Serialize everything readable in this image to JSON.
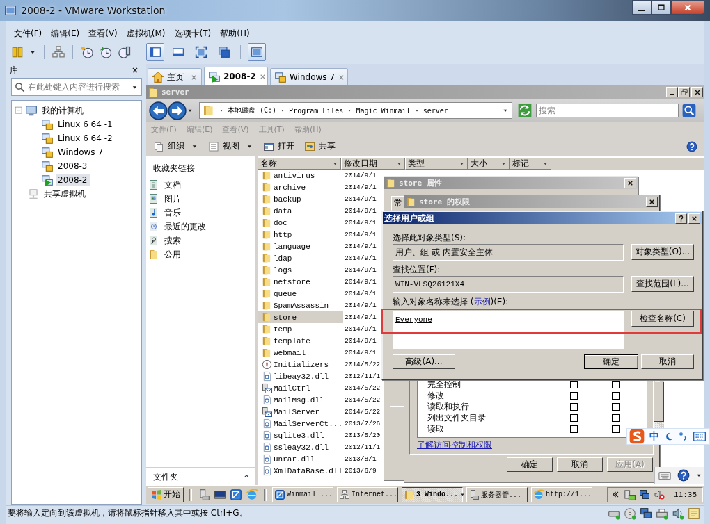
{
  "window": {
    "title": "2008-2 - VMware Workstation"
  },
  "menu": [
    "文件(F)",
    "编辑(E)",
    "查看(V)",
    "虚拟机(M)",
    "选项卡(T)",
    "帮助(H)"
  ],
  "view_modes": [
    {
      "on": true
    },
    {
      "on": false
    },
    {
      "on": false
    },
    {
      "on": false
    },
    {
      "on": true
    }
  ],
  "library": {
    "title": "库",
    "search_placeholder": "在此处键入内容进行搜索",
    "tree": [
      {
        "label": "我的计算机",
        "kind": "computer",
        "expanded": true,
        "selected": false,
        "children": [
          {
            "label": "Linux 6 64 -1",
            "kind": "vm",
            "selected": false
          },
          {
            "label": "Linux 6 64 -2",
            "kind": "vm",
            "selected": false
          },
          {
            "label": "Windows 7",
            "kind": "vm",
            "selected": false
          },
          {
            "label": "2008-3",
            "kind": "vm",
            "selected": false
          },
          {
            "label": "2008-2",
            "kind": "vm-running",
            "selected": true
          }
        ]
      },
      {
        "label": "共享虚拟机",
        "kind": "shared",
        "selected": false
      }
    ]
  },
  "tabs": [
    {
      "label": "主页",
      "kind": "home",
      "selected": false
    },
    {
      "label": "2008-2",
      "kind": "vm-running",
      "selected": true
    },
    {
      "label": "Windows 7",
      "kind": "vm",
      "selected": false
    }
  ],
  "explorer": {
    "title": "server",
    "breadcrumb": [
      "本地磁盘 (C:)",
      "Program Files",
      "Magic Winmail",
      "server"
    ],
    "search_placeholder": "搜索",
    "menu": [
      "文件(F)",
      "编辑(E)",
      "查看(V)",
      "工具(T)",
      "帮助(H)"
    ],
    "toolbar": [
      {
        "label": "组织",
        "kind": "organize",
        "dropdown": true
      },
      {
        "label": "视图",
        "kind": "views",
        "dropdown": true
      },
      {
        "label": "打开",
        "kind": "open",
        "dropdown": false
      },
      {
        "label": "共享",
        "kind": "share",
        "dropdown": false
      }
    ],
    "favorites_title": "收藏夹链接",
    "favorites": [
      {
        "label": "文档",
        "kind": "documents"
      },
      {
        "label": "图片",
        "kind": "pictures"
      },
      {
        "label": "音乐",
        "kind": "music"
      },
      {
        "label": "最近的更改",
        "kind": "recent"
      },
      {
        "label": "搜索",
        "kind": "searches"
      },
      {
        "label": "公用",
        "kind": "folder"
      }
    ],
    "folders_label": "文件夹",
    "columns": [
      "名称",
      "修改日期",
      "类型",
      "大小",
      "标记"
    ],
    "files": [
      {
        "name": "antivirus",
        "date": "2014/9/1",
        "kind": "folder",
        "selected": false
      },
      {
        "name": "archive",
        "date": "2014/9/1",
        "kind": "folder",
        "selected": false
      },
      {
        "name": "backup",
        "date": "2014/9/1",
        "kind": "folder",
        "selected": false
      },
      {
        "name": "data",
        "date": "2014/9/1",
        "kind": "folder",
        "selected": false
      },
      {
        "name": "doc",
        "date": "2014/9/1",
        "kind": "folder",
        "selected": false
      },
      {
        "name": "http",
        "date": "2014/9/1",
        "kind": "folder",
        "selected": false
      },
      {
        "name": "language",
        "date": "2014/9/1",
        "kind": "folder",
        "selected": false
      },
      {
        "name": "ldap",
        "date": "2014/9/1",
        "kind": "folder",
        "selected": false
      },
      {
        "name": "logs",
        "date": "2014/9/1",
        "kind": "folder",
        "selected": false
      },
      {
        "name": "netstore",
        "date": "2014/9/1",
        "kind": "folder",
        "selected": false
      },
      {
        "name": "queue",
        "date": "2014/9/1",
        "kind": "folder",
        "selected": false
      },
      {
        "name": "SpamAssassin",
        "date": "2014/9/1",
        "kind": "folder",
        "selected": false
      },
      {
        "name": "store",
        "date": "2014/9/1",
        "kind": "folder",
        "selected": true
      },
      {
        "name": "temp",
        "date": "2014/9/1",
        "kind": "folder",
        "selected": false
      },
      {
        "name": "template",
        "date": "2014/9/1",
        "kind": "folder",
        "selected": false
      },
      {
        "name": "webmail",
        "date": "2014/9/1",
        "kind": "folder",
        "selected": false
      },
      {
        "name": "Initializers",
        "date": "2014/5/22",
        "kind": "exe",
        "selected": false
      },
      {
        "name": "libeay32.dll",
        "date": "2012/11/1",
        "kind": "dll",
        "selected": false
      },
      {
        "name": "MailCtrl",
        "date": "2014/5/22",
        "kind": "app",
        "selected": false
      },
      {
        "name": "MailMsg.dll",
        "date": "2014/5/22",
        "kind": "dll",
        "selected": false
      },
      {
        "name": "MailServer",
        "date": "2014/5/22",
        "kind": "app",
        "selected": false
      },
      {
        "name": "MailServerCt...",
        "date": "2013/7/26",
        "kind": "dll",
        "selected": false
      },
      {
        "name": "sqlite3.dll",
        "date": "2013/5/20",
        "kind": "dll",
        "selected": false
      },
      {
        "name": "ssleay32.dll",
        "date": "2012/11/1",
        "kind": "dll",
        "selected": false
      },
      {
        "name": "unrar.dll",
        "date": "2013/8/1",
        "kind": "dll",
        "selected": false
      },
      {
        "name": "XmlDataBase.dll",
        "date": "2013/6/9",
        "kind": "dll",
        "selected": false
      }
    ]
  },
  "properties_dialog": {
    "title": "store 属性",
    "tab": "常"
  },
  "permissions_dialog": {
    "title": "store 的权限",
    "permissions": [
      {
        "name": "完全控制",
        "allow": false,
        "deny": false
      },
      {
        "name": "修改",
        "allow": false,
        "deny": false
      },
      {
        "name": "读取和执行",
        "allow": false,
        "deny": false
      },
      {
        "name": "列出文件夹目录",
        "allow": false,
        "deny": false
      },
      {
        "name": "读取",
        "allow": false,
        "deny": false
      }
    ],
    "link": "了解访问控制和权限",
    "buttons": [
      {
        "label": "确定",
        "disabled": false
      },
      {
        "label": "取消",
        "disabled": false
      },
      {
        "label": "应用(A)",
        "disabled": true
      }
    ]
  },
  "select_dialog": {
    "title": "选择用户或组",
    "type_label": "选择此对象类型(S):",
    "type_value": "用户、组 或 内置安全主体",
    "type_button": "对象类型(O)...",
    "location_label": "查找位置(F):",
    "location_value": "WIN-VLSQ26121X4",
    "location_button": "查找范围(L)...",
    "names_label_before": "输入对象名称来选择 (",
    "names_label_link": "示例",
    "names_label_after": ")(E):",
    "names_value": "Everyone",
    "check_button": "检查名称(C)",
    "advanced_button": "高级(A)...",
    "ok_button": "确定",
    "cancel_button": "取消"
  },
  "taskbar": {
    "start": "开始",
    "items": [
      {
        "label": "Winmail ...",
        "kind": "mail",
        "selected": false
      },
      {
        "label": "Internet...",
        "kind": "network",
        "selected": false
      },
      {
        "label": "3 Windo...",
        "kind": "folder",
        "selected": true
      },
      {
        "label": "服务器管...",
        "kind": "server",
        "selected": false
      },
      {
        "label": "http://1...",
        "kind": "browser",
        "selected": false
      }
    ],
    "clock": "11:35"
  },
  "ime": {
    "label": "中"
  },
  "status_bar": "要将输入定向到该虚拟机，请将鼠标指针移入其中或按 Ctrl+G。"
}
